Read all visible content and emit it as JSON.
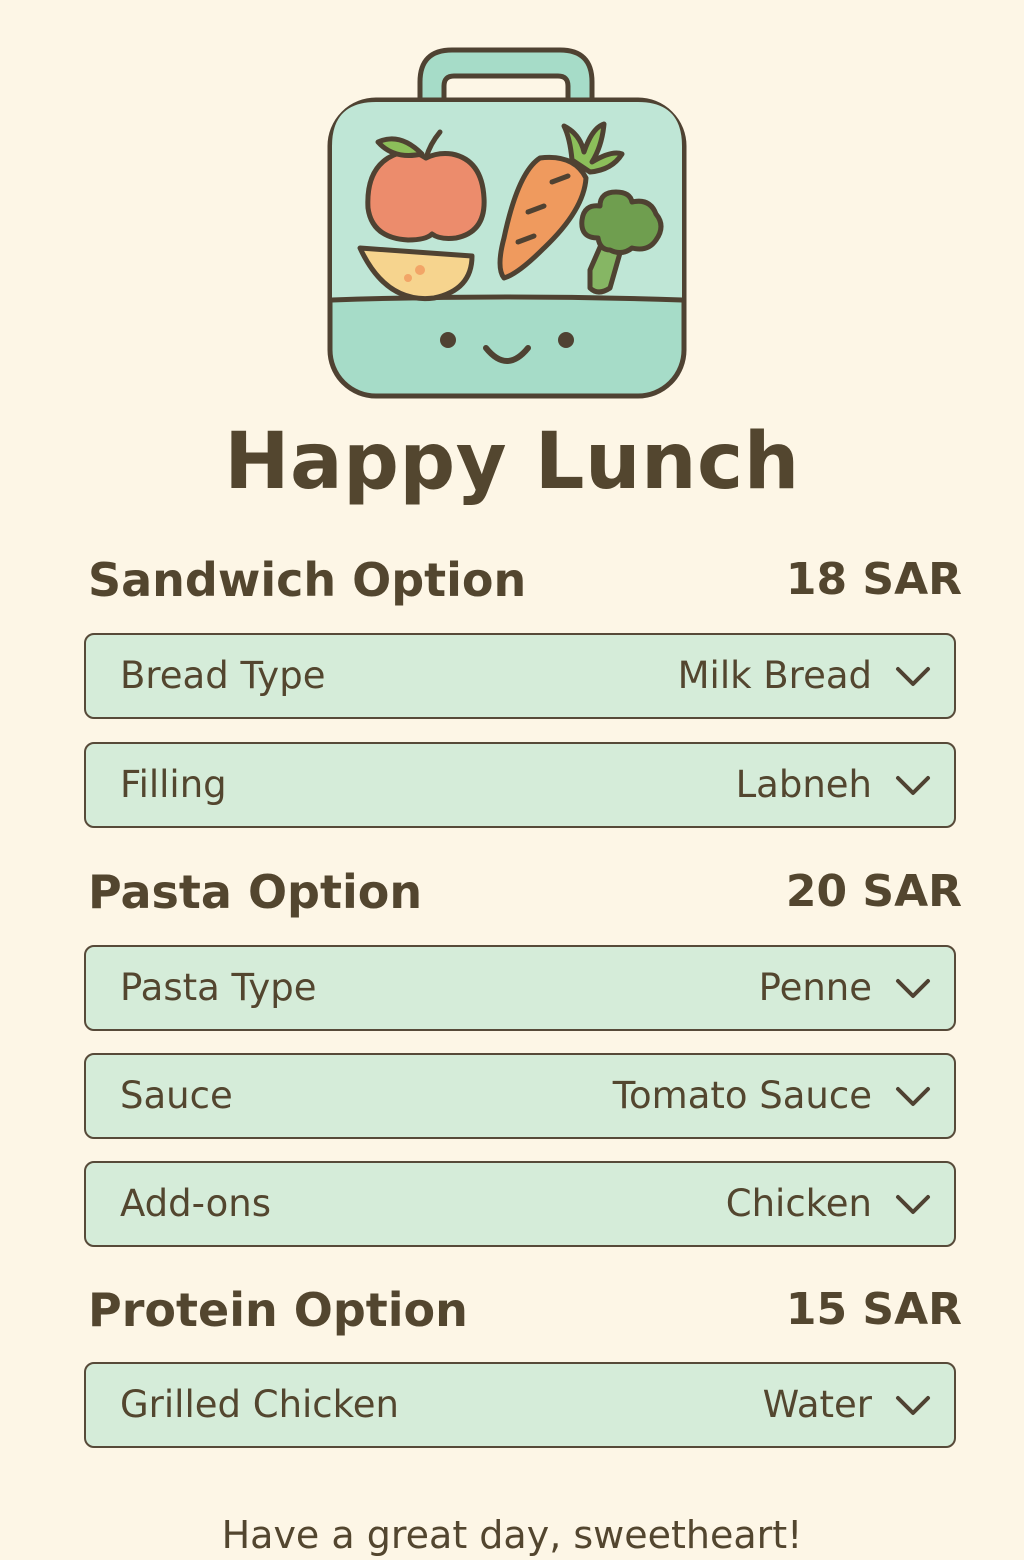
{
  "app": {
    "title": "Happy Lunch",
    "footer": "Have a great day, sweetheart!"
  },
  "logo": {
    "icon": "lunchbox-icon"
  },
  "sections": [
    {
      "title": "Sandwich Option",
      "price": "18 SAR",
      "selects": [
        {
          "label": "Bread Type",
          "value": "Milk Bread"
        },
        {
          "label": "Filling",
          "value": "Labneh"
        }
      ]
    },
    {
      "title": "Pasta Option",
      "price": "20 SAR",
      "selects": [
        {
          "label": "Pasta Type",
          "value": "Penne"
        },
        {
          "label": "Sauce",
          "value": "Tomato Sauce"
        },
        {
          "label": "Add-ons",
          "value": "Chicken"
        }
      ]
    },
    {
      "title": "Protein Option",
      "price": "15 SAR",
      "selects": [
        {
          "label": "Grilled Chicken",
          "value": "Water"
        }
      ]
    }
  ],
  "colors": {
    "background": "#fdf6e6",
    "select_fill": "#d5ecd9",
    "text": "#53462f",
    "lunchbox": "#a6dcc8",
    "apple": "#ec8c6c",
    "carrot": "#ef9a5e",
    "broccoli": "#6f9e4f"
  }
}
